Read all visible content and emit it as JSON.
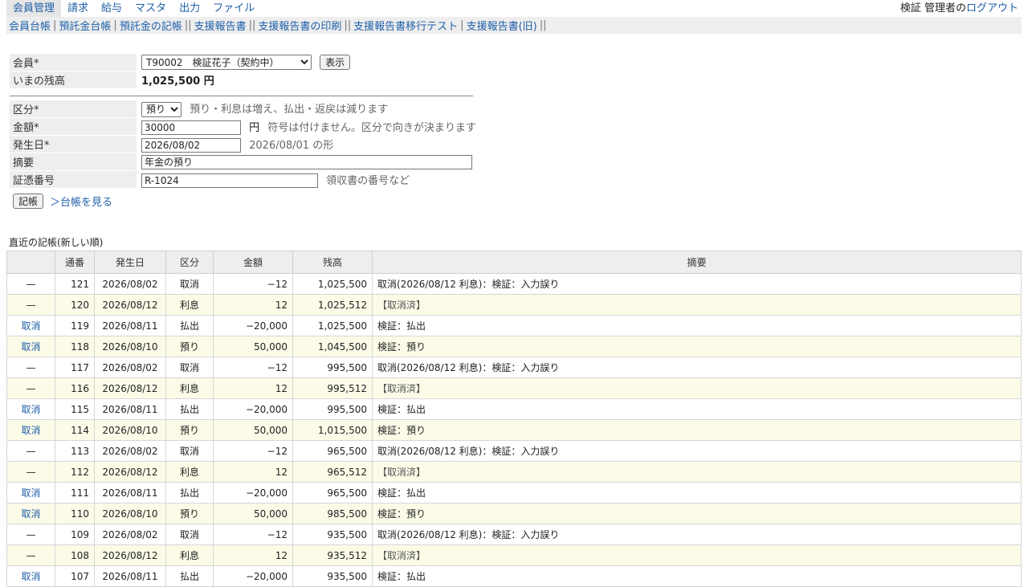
{
  "top_menu": {
    "items": [
      "会員管理",
      "請求",
      "給与",
      "マスタ",
      "出力",
      "ファイル"
    ],
    "active_index": 0
  },
  "user": {
    "name": "検証 管理者の",
    "logout_label": "ログアウト"
  },
  "sub_menu": {
    "items": [
      "会員台帳",
      "預託金台帳",
      "預託金の記帳",
      "支援報告書",
      "支援報告書の印刷",
      "支援報告書移行テスト",
      "支援報告書(旧)"
    ],
    "separators": [
      "|",
      "|",
      "||",
      "||",
      "||",
      "|",
      "||"
    ]
  },
  "member_form": {
    "member_label": "会員*",
    "member_selected": "T90002　検証花子（契約中）",
    "show_button": "表示",
    "balance_label": "いまの残高",
    "balance_value": "1,025,500 円"
  },
  "entry_form": {
    "kubun_label": "区分*",
    "kubun_selected": "預り",
    "kubun_hint": "預り・利息は増え、払出・返戻は減ります",
    "amount_label": "金額*",
    "amount_value": "30000",
    "amount_unit": "円",
    "amount_hint": "符号は付けません。区分で向きが決まります",
    "date_label": "発生日*",
    "date_value": "2026/08/02",
    "date_hint": "2026/08/01 の形",
    "summary_label": "摘要",
    "summary_value": "年金の預り",
    "voucher_label": "証憑番号",
    "voucher_value": "R-1024",
    "voucher_hint": "領収書の番号など",
    "post_button": "記帳",
    "ledger_link": "＞台帳を見る"
  },
  "recent": {
    "title": "直近の記帳(新しい順)",
    "columns": [
      "",
      "通番",
      "発生日",
      "区分",
      "金額",
      "残高",
      "摘要"
    ],
    "rows": [
      {
        "action": "—",
        "no": "121",
        "date": "2026/08/02",
        "kubun": "取消",
        "amount": "−12",
        "balance": "1,025,500",
        "summary": "取消(2026/08/12 利息)：検証：入力誤り"
      },
      {
        "action": "—",
        "no": "120",
        "date": "2026/08/12",
        "kubun": "利息",
        "amount": "12",
        "balance": "1,025,512",
        "summary": "【取消済】"
      },
      {
        "action": "取消",
        "no": "119",
        "date": "2026/08/11",
        "kubun": "払出",
        "amount": "−20,000",
        "balance": "1,025,500",
        "summary": "検証：払出"
      },
      {
        "action": "取消",
        "no": "118",
        "date": "2026/08/10",
        "kubun": "預り",
        "amount": "50,000",
        "balance": "1,045,500",
        "summary": "検証：預り"
      },
      {
        "action": "—",
        "no": "117",
        "date": "2026/08/02",
        "kubun": "取消",
        "amount": "−12",
        "balance": "995,500",
        "summary": "取消(2026/08/12 利息)：検証：入力誤り"
      },
      {
        "action": "—",
        "no": "116",
        "date": "2026/08/12",
        "kubun": "利息",
        "amount": "12",
        "balance": "995,512",
        "summary": "【取消済】"
      },
      {
        "action": "取消",
        "no": "115",
        "date": "2026/08/11",
        "kubun": "払出",
        "amount": "−20,000",
        "balance": "995,500",
        "summary": "検証：払出"
      },
      {
        "action": "取消",
        "no": "114",
        "date": "2026/08/10",
        "kubun": "預り",
        "amount": "50,000",
        "balance": "1,015,500",
        "summary": "検証：預り"
      },
      {
        "action": "—",
        "no": "113",
        "date": "2026/08/02",
        "kubun": "取消",
        "amount": "−12",
        "balance": "965,500",
        "summary": "取消(2026/08/12 利息)：検証：入力誤り"
      },
      {
        "action": "—",
        "no": "112",
        "date": "2026/08/12",
        "kubun": "利息",
        "amount": "12",
        "balance": "965,512",
        "summary": "【取消済】"
      },
      {
        "action": "取消",
        "no": "111",
        "date": "2026/08/11",
        "kubun": "払出",
        "amount": "−20,000",
        "balance": "965,500",
        "summary": "検証：払出"
      },
      {
        "action": "取消",
        "no": "110",
        "date": "2026/08/10",
        "kubun": "預り",
        "amount": "50,000",
        "balance": "985,500",
        "summary": "検証：預り"
      },
      {
        "action": "—",
        "no": "109",
        "date": "2026/08/02",
        "kubun": "取消",
        "amount": "−12",
        "balance": "935,500",
        "summary": "取消(2026/08/12 利息)：検証：入力誤り"
      },
      {
        "action": "—",
        "no": "108",
        "date": "2026/08/12",
        "kubun": "利息",
        "amount": "12",
        "balance": "935,512",
        "summary": "【取消済】"
      },
      {
        "action": "取消",
        "no": "107",
        "date": "2026/08/11",
        "kubun": "払出",
        "amount": "−20,000",
        "balance": "935,500",
        "summary": "検証：払出"
      }
    ]
  },
  "colors": {
    "link": "#1f5fa8",
    "header_bg": "#eeeeee",
    "alt_row_bg": "#fbfbe8"
  }
}
